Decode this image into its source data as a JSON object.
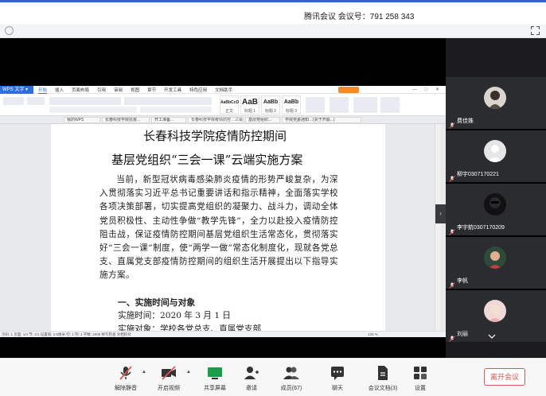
{
  "meeting": {
    "title": "腾讯会议 会议号：791 258 343"
  },
  "wps": {
    "app_label": "WPS 文字 ▾",
    "ribbon_tabs": [
      "开始",
      "插入",
      "页面布局",
      "引用",
      "审阅",
      "视图",
      "章节",
      "开发工具",
      "特色应用",
      "文档助手"
    ],
    "active_tab": "开始",
    "style_gallery": [
      "AaBbCcD",
      "AaB",
      "AaBb",
      "AaBb"
    ],
    "style_names": [
      "正文",
      "标题 1",
      "标题 2",
      "标题 3"
    ],
    "doc_tabs": [
      "我的WPS",
      "长春科技学院抗疫...",
      "开工准备...",
      "长春科技学院疫情防控…三会一课",
      "基层党组织...",
      "学院党委通知…(关于开展...)"
    ],
    "statusbar": "页码: 1  页面: 1/4  节: 1/1  设置值: 2.5厘米  行: 1  列: 1  字数: 2009  拼写检查  文档校对",
    "zoom": "130 %"
  },
  "document": {
    "title_line1": "长春科技学院疫情防控期间",
    "title_line2": "基层党组织“三会一课”云端实施方案",
    "paragraph": "当前，新型冠状病毒感染肺炎疫情的形势严峻复杂，为深入贯彻落实习近平总书记重要讲话和指示精神，全面落实学校各项决策部署，切实提高党组织的凝聚力、战斗力，调动全体党员积极性、主动性争做“教学先锋”，全力以赴投入疫情防控阻击战，保证疫情防控期间基层党组织生活常态化，贯彻落实好“三会一课”制度，使“两学一做”常态化制度化，现就各党总支、直属党支部疫情防控期间的组织生活开展提出以下指导实施方案。",
    "section1_heading": "一、实施时间与对象",
    "time_line": "实施时间：2020 年 3 月 1 日",
    "object_line": "实施对象：学校各党总支、直属党支部"
  },
  "participants": [
    {
      "name": "费佳姝",
      "avatar": "photo"
    },
    {
      "name": "柳宇0307170221",
      "avatar": "default"
    },
    {
      "name": "李宇航0307170209",
      "avatar": "photo"
    },
    {
      "name": "李帆",
      "avatar": "photo"
    },
    {
      "name": "刘丽",
      "avatar": "photo"
    }
  ],
  "toolbar": {
    "unmute": "解除静音",
    "video": "开启视频",
    "share": "共享屏幕",
    "invite": "邀请",
    "members": "成员(67)",
    "chat": "聊天",
    "docs": "会议文档(3)",
    "settings": "设置",
    "leave": "离开会议"
  },
  "colors": {
    "accent": "#2f66d0",
    "wps_blue": "#2e6fdb",
    "leave_red": "#e05555",
    "tile_bg": "#2b2c30"
  }
}
